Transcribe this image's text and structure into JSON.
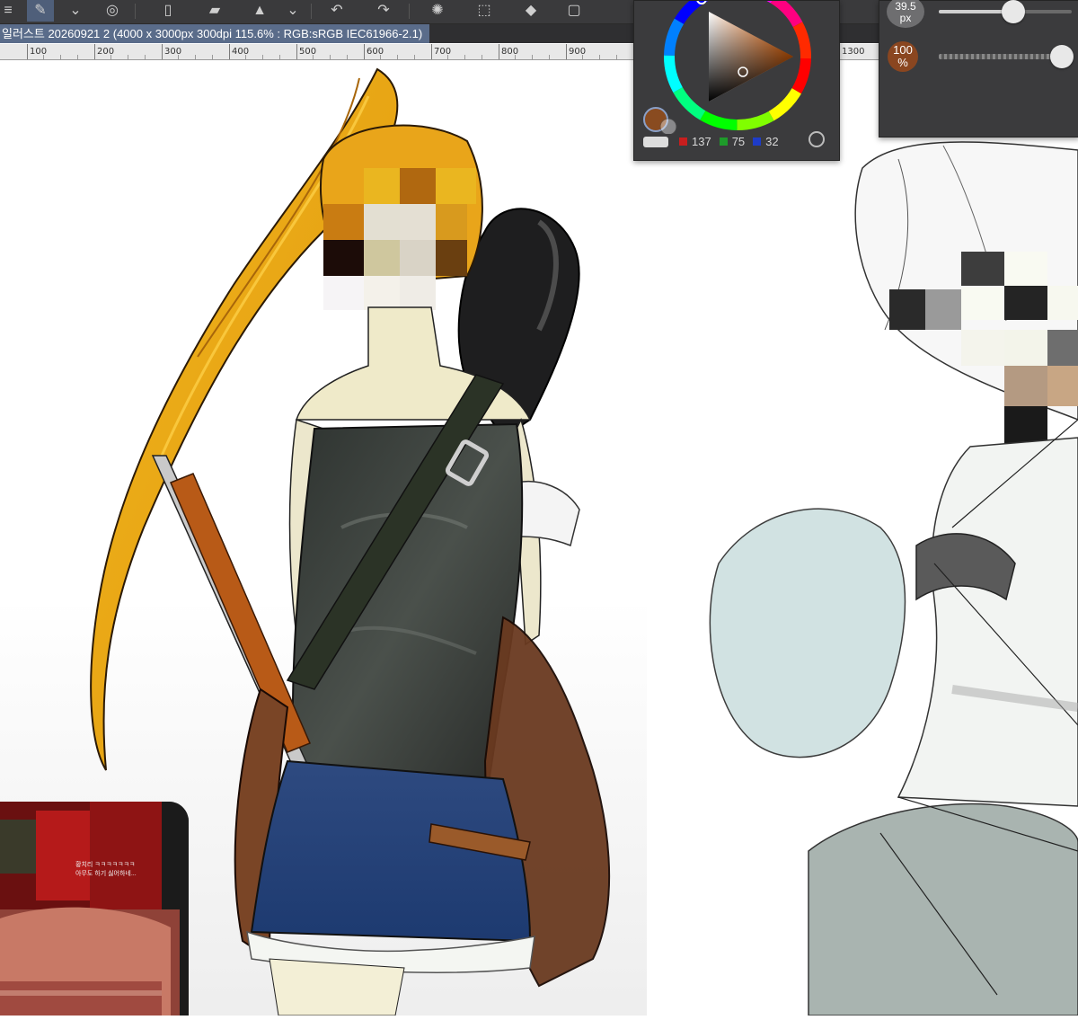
{
  "toolbar": {
    "buttons": [
      {
        "name": "menu-icon",
        "glyph": "≡"
      },
      {
        "name": "pen-tool-icon",
        "glyph": "✎",
        "active": true
      },
      {
        "name": "chevron-down-icon",
        "glyph": "⌄"
      },
      {
        "name": "lasso-icon",
        "glyph": "◎"
      },
      {
        "name": "new-file-icon",
        "glyph": "▯"
      },
      {
        "name": "folder-icon",
        "glyph": "▰"
      },
      {
        "name": "save-icon",
        "glyph": "▲"
      },
      {
        "name": "chevron-down-icon",
        "glyph": "⌄"
      },
      {
        "name": "undo-icon",
        "glyph": "↶"
      },
      {
        "name": "redo-icon",
        "glyph": "↷"
      },
      {
        "name": "loading-icon",
        "glyph": "✺"
      },
      {
        "name": "selection-icon",
        "glyph": "⬚"
      },
      {
        "name": "fill-icon",
        "glyph": "◆"
      },
      {
        "name": "transform-icon",
        "glyph": "▢"
      }
    ]
  },
  "document": {
    "tab_title": "일러스트 20260921 2 (4000 x 3000px 300dpi 115.6% : RGB:sRGB IEC61966-2.1)"
  },
  "ruler": {
    "labels": [
      "100",
      "200",
      "300",
      "400",
      "500",
      "600",
      "700",
      "800",
      "900",
      "1300"
    ]
  },
  "color_panel": {
    "current_color": "#894b20",
    "r": "137",
    "g": "75",
    "b": "32",
    "r_color": "#c81e1e",
    "g_color": "#1e9b2a",
    "b_color": "#1e3cc8"
  },
  "brush_panel": {
    "size_value": "39.5",
    "size_unit": "px",
    "opacity_value": "100",
    "opacity_unit": "%",
    "size_level": 0.76,
    "opacity_level": 1.0
  },
  "video_overlay": {
    "caption_line1": "황치리 ㅋㅋㅋㅋㅋㅋㅋ",
    "caption_line2": "아무도 하기 싫어하네..."
  }
}
